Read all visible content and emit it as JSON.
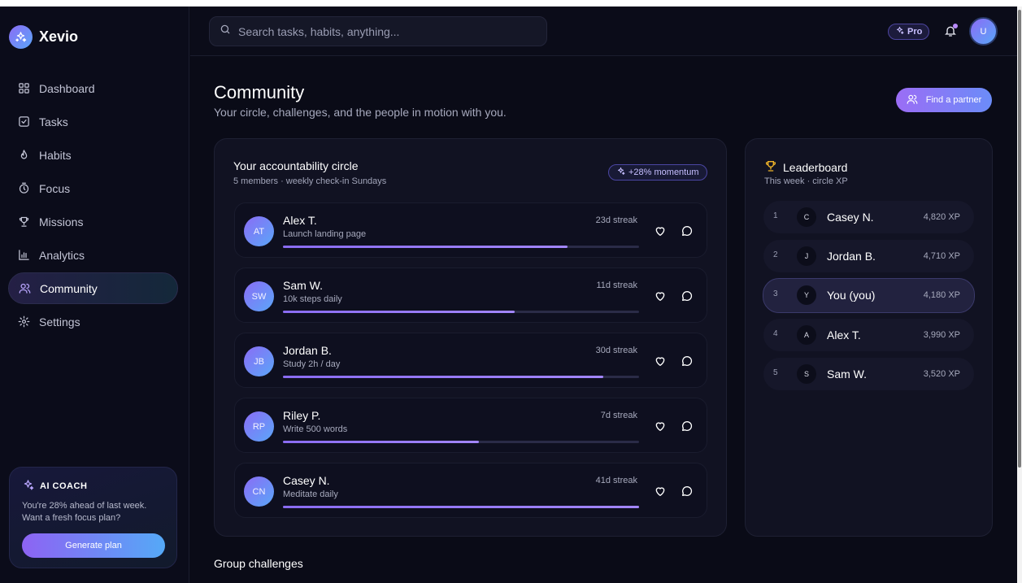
{
  "brand": {
    "name": "Xevio"
  },
  "sidebar": {
    "items": [
      {
        "label": "Dashboard",
        "icon": "dashboard-icon",
        "active": false
      },
      {
        "label": "Tasks",
        "icon": "tasks-icon",
        "active": false
      },
      {
        "label": "Habits",
        "icon": "flame-icon",
        "active": false
      },
      {
        "label": "Focus",
        "icon": "timer-icon",
        "active": false
      },
      {
        "label": "Missions",
        "icon": "trophy-icon",
        "active": false
      },
      {
        "label": "Analytics",
        "icon": "bar-chart-icon",
        "active": false
      },
      {
        "label": "Community",
        "icon": "users-icon",
        "active": true
      },
      {
        "label": "Settings",
        "icon": "gear-icon",
        "active": false
      }
    ]
  },
  "coach": {
    "title": "AI COACH",
    "text": "You're 28% ahead of last week. Want a fresh focus plan?",
    "button": "Generate plan"
  },
  "header": {
    "search_placeholder": "Search tasks, habits, anything...",
    "pro_label": "Pro",
    "user_initial": "U"
  },
  "page": {
    "title": "Community",
    "subtitle": "Your circle, challenges, and the people in motion with you.",
    "find_partner_label": "Find a partner"
  },
  "circle": {
    "title": "Your accountability circle",
    "subtitle": "5 members · weekly check-in Sundays",
    "momentum": "+28% momentum",
    "members": [
      {
        "initials": "AT",
        "name": "Alex T.",
        "goal": "Launch landing page",
        "streak": "23d streak",
        "progress": 0.8
      },
      {
        "initials": "SW",
        "name": "Sam W.",
        "goal": "10k steps daily",
        "streak": "11d streak",
        "progress": 0.65
      },
      {
        "initials": "JB",
        "name": "Jordan B.",
        "goal": "Study 2h / day",
        "streak": "30d streak",
        "progress": 0.9
      },
      {
        "initials": "RP",
        "name": "Riley P.",
        "goal": "Write 500 words",
        "streak": "7d streak",
        "progress": 0.55
      },
      {
        "initials": "CN",
        "name": "Casey N.",
        "goal": "Meditate daily",
        "streak": "41d streak",
        "progress": 1.0
      }
    ]
  },
  "leaderboard": {
    "title": "Leaderboard",
    "subtitle": "This week · circle XP",
    "rows": [
      {
        "rank": "1",
        "initial": "C",
        "name": "Casey N.",
        "xp": "4,820 XP",
        "me": false
      },
      {
        "rank": "2",
        "initial": "J",
        "name": "Jordan B.",
        "xp": "4,710 XP",
        "me": false
      },
      {
        "rank": "3",
        "initial": "Y",
        "name": "You (you)",
        "xp": "4,180 XP",
        "me": true
      },
      {
        "rank": "4",
        "initial": "A",
        "name": "Alex T.",
        "xp": "3,990 XP",
        "me": false
      },
      {
        "rank": "5",
        "initial": "S",
        "name": "Sam W.",
        "xp": "3,520 XP",
        "me": false
      }
    ]
  },
  "challenges": {
    "title": "Group challenges"
  },
  "colors": {
    "accent": "#8b6cf6",
    "accent2": "#5aa6f8",
    "background": "#0a0b17",
    "card": "#111222"
  }
}
